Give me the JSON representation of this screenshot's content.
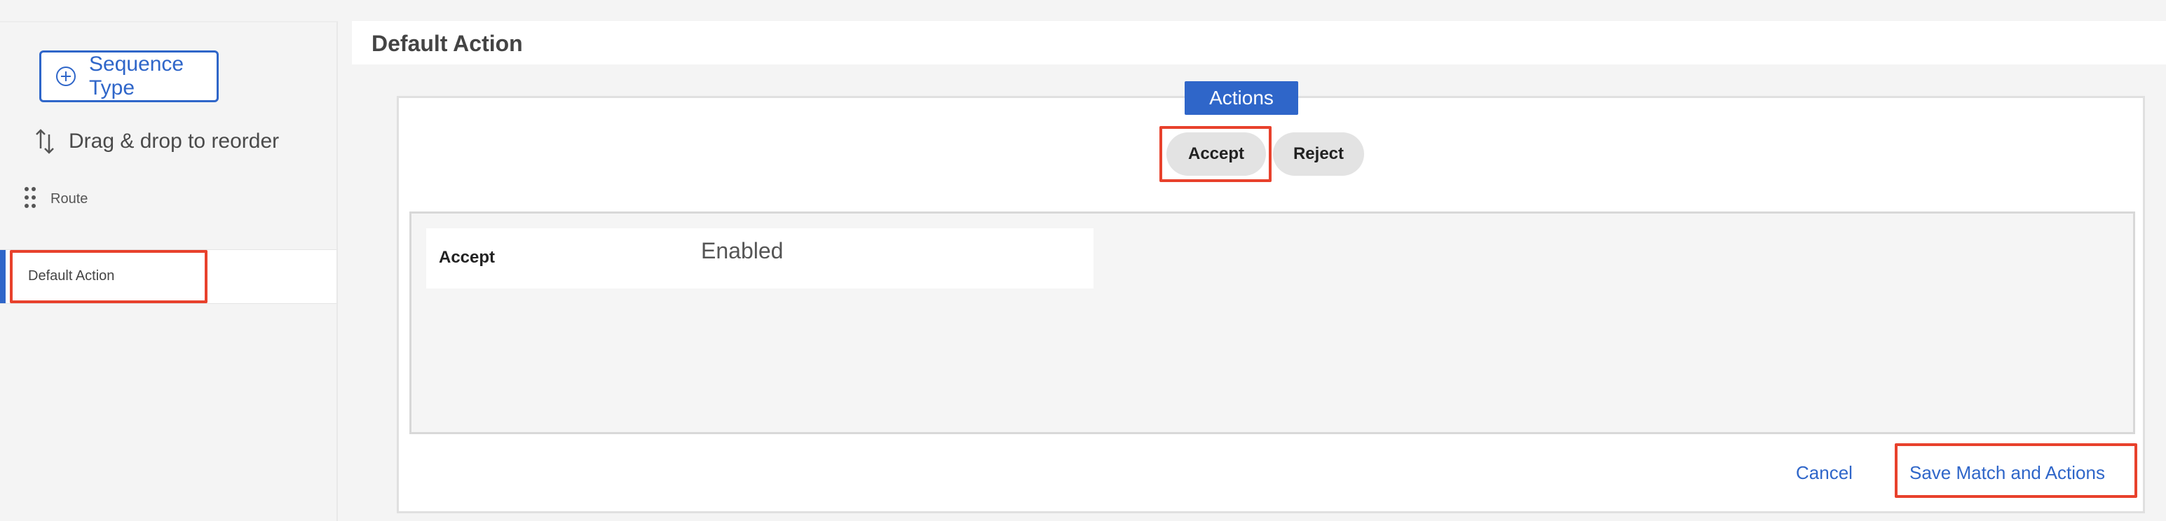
{
  "sidebar": {
    "sequence_type_label": "Sequence Type",
    "drag_hint": "Drag & drop to reorder",
    "items": [
      {
        "label": "Route"
      },
      {
        "label": "Default Action"
      }
    ]
  },
  "header": {
    "title": "Default Action"
  },
  "actions": {
    "tag": "Actions",
    "options": [
      {
        "label": "Accept"
      },
      {
        "label": "Reject"
      }
    ],
    "detail": {
      "key": "Accept",
      "value": "Enabled"
    }
  },
  "footer": {
    "cancel_label": "Cancel",
    "save_label": "Save Match and Actions"
  },
  "colors": {
    "accent": "#2f66c9",
    "highlight": "#e8412c"
  }
}
